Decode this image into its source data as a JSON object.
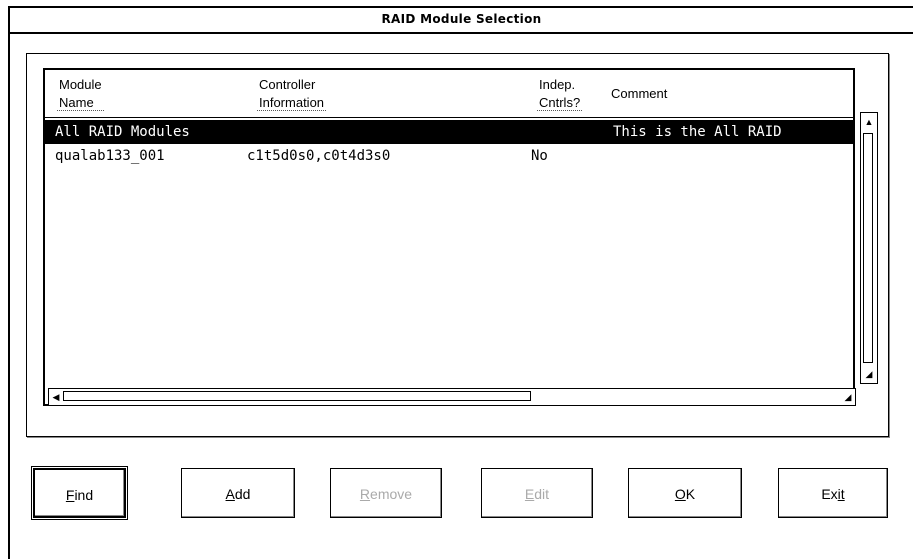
{
  "window": {
    "title": "RAID Module Selection"
  },
  "table": {
    "columns": [
      {
        "line1": "Module",
        "line2": "Name"
      },
      {
        "line1": "Controller",
        "line2": "Information"
      },
      {
        "line1": "Indep.",
        "line2": "Cntrls?"
      },
      {
        "line1": "Comment",
        "line2": ""
      }
    ],
    "rows": [
      {
        "name": "All RAID Modules",
        "controller": "",
        "indep": "",
        "comment": "This is the All RAID",
        "selected": true
      },
      {
        "name": "qualab133_001",
        "controller": "c1t5d0s0,c0t4d3s0",
        "indep": "No",
        "comment": "",
        "selected": false
      }
    ]
  },
  "buttons": [
    {
      "label_first": "F",
      "label_rest": "ind",
      "enabled": true,
      "default": true
    },
    {
      "label_first": "A",
      "label_rest": "dd",
      "enabled": true,
      "default": false
    },
    {
      "label_first": "R",
      "label_rest": "emove",
      "enabled": false,
      "default": false
    },
    {
      "label_first": "E",
      "label_rest": "dit",
      "enabled": false,
      "default": false
    },
    {
      "label_first": "O",
      "label_rest": "K",
      "enabled": true,
      "default": false
    },
    {
      "label_first": "Ex",
      "label_rest": "it",
      "enabled": true,
      "default": false
    }
  ]
}
